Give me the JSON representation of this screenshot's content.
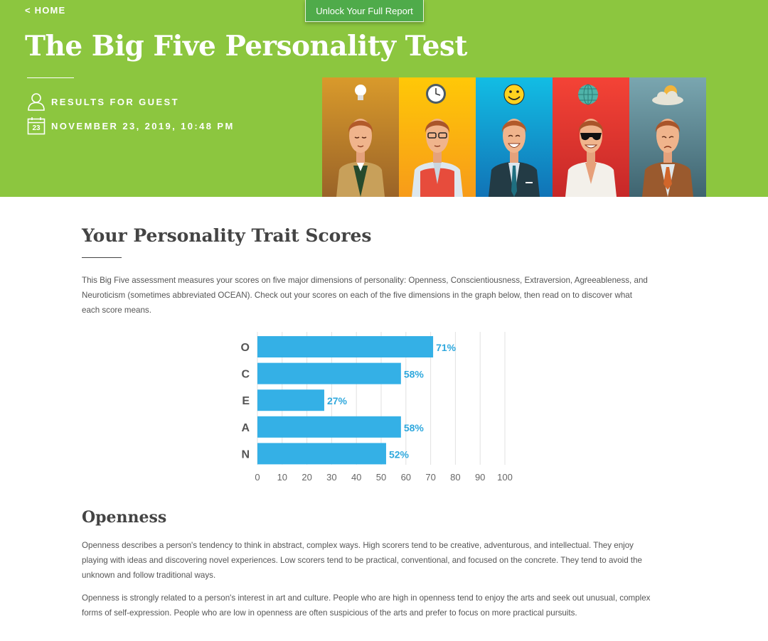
{
  "header": {
    "home_link": "< HOME",
    "unlock_button": "Unlock Your Full Report",
    "title": "The Big Five Personality Test",
    "results_for": "RESULTS FOR GUEST",
    "date": "NOVEMBER 23, 2019, 10:48 PM",
    "calendar_day": "23",
    "bg_color": "#8cc63f",
    "button_color": "#4fab4a",
    "icons": [
      "user-icon",
      "calendar-icon"
    ],
    "illustration_panels": [
      {
        "icon": "lightbulb-icon",
        "color": "#c98a2d"
      },
      {
        "icon": "clock-icon",
        "color": "#f5b20a"
      },
      {
        "icon": "smiley-icon",
        "color": "#14aee0"
      },
      {
        "icon": "globe-icon",
        "color": "#e53935"
      },
      {
        "icon": "cloud-sun-icon",
        "color": "#5b8b96"
      }
    ]
  },
  "main": {
    "section_title": "Your Personality Trait Scores",
    "intro": "This Big Five assessment measures your scores on five major dimensions of personality: Openness, Conscientiousness, Extraversion, Agreeableness, and Neuroticism (sometimes abbreviated OCEAN). Check out your scores on each of the five dimensions in the graph below, then read on to discover what each score means.",
    "openness_title": "Openness",
    "openness_p1": "Openness describes a person's tendency to think in abstract, complex ways. High scorers tend to be creative, adventurous, and intellectual. They enjoy playing with ideas and discovering novel experiences. Low scorers tend to be practical, conventional, and focused on the concrete. They tend to avoid the unknown and follow traditional ways.",
    "openness_p2": "Openness is strongly related to a person's interest in art and culture. People who are high in openness tend to enjoy the arts and seek out unusual, complex forms of self-expression. People who are low in openness are often suspicious of the arts and prefer to focus on more practical pursuits."
  },
  "chart_data": {
    "type": "bar",
    "orientation": "horizontal",
    "categories": [
      "O",
      "C",
      "E",
      "A",
      "N"
    ],
    "values": [
      71,
      58,
      27,
      58,
      52
    ],
    "value_labels": [
      "71%",
      "58%",
      "27%",
      "58%",
      "52%"
    ],
    "xlim": [
      0,
      100
    ],
    "xticks": [
      0,
      10,
      20,
      30,
      40,
      50,
      60,
      70,
      80,
      90,
      100
    ],
    "bar_color": "#34b0e6",
    "label_color": "#2fa8dd",
    "grid": true
  }
}
